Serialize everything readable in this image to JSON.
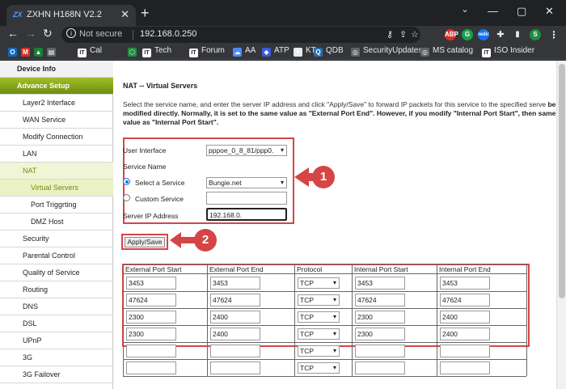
{
  "browser": {
    "tab_title": "ZXHN H168N V2.2",
    "tab_favicon": "ZX",
    "new_tab": "+",
    "close": "✕",
    "minimize": "—",
    "maximize": "▢",
    "not_secure": "Not secure",
    "url": "192.168.0.250",
    "redir_badge": "redir"
  },
  "bookmarks": [
    {
      "label": "",
      "icon": "outlook-icon",
      "color": "#0f6cbd",
      "glyph": "O"
    },
    {
      "label": "",
      "icon": "gmail-icon",
      "color": "#d93025",
      "glyph": "M"
    },
    {
      "label": "",
      "icon": "drive-icon",
      "color": "#188038",
      "glyph": "▲"
    },
    {
      "label": "",
      "icon": "sheets-icon",
      "color": "#5f6368",
      "glyph": "▤"
    },
    {
      "label": "Cal",
      "icon": "it-icon",
      "color": "#fff",
      "glyph": "IT"
    },
    {
      "label": "",
      "icon": "green-icon",
      "color": "#1e8e3e",
      "glyph": "⬡"
    },
    {
      "label": "Tech",
      "icon": "it-icon",
      "color": "#fff",
      "glyph": "IT"
    },
    {
      "label": "Forum",
      "icon": "it-icon",
      "color": "#fff",
      "glyph": "IT"
    },
    {
      "label": "AA",
      "icon": "cloud-icon",
      "color": "#4c8bf5",
      "glyph": "☁"
    },
    {
      "label": "ATP",
      "icon": "defender-icon",
      "color": "#3b5bdb",
      "glyph": "◆"
    },
    {
      "label": "KT",
      "icon": "pin-icon",
      "color": "#e8eaed",
      "glyph": "✦"
    },
    {
      "label": "QDB",
      "icon": "q-icon",
      "color": "#2b6cb0",
      "glyph": "Q"
    },
    {
      "label": "SecurityUpdates",
      "icon": "globe-icon",
      "color": "#5f6368",
      "glyph": "◎"
    },
    {
      "label": "MS catalog",
      "icon": "globe-icon",
      "color": "#5f6368",
      "glyph": "◎"
    },
    {
      "label": "ISO Insider",
      "icon": "it-icon",
      "color": "#fff",
      "glyph": "IT"
    }
  ],
  "sidebar": {
    "items": [
      {
        "label": "Device Info",
        "kind": "top"
      },
      {
        "label": "Advance Setup",
        "kind": "adv"
      },
      {
        "label": "Layer2 Interface",
        "kind": "l1"
      },
      {
        "label": "WAN Service",
        "kind": "l1"
      },
      {
        "label": "Modify Connection",
        "kind": "l1"
      },
      {
        "label": "LAN",
        "kind": "l1"
      },
      {
        "label": "NAT",
        "kind": "nat"
      },
      {
        "label": "Virtual Servers",
        "kind": "l2 active"
      },
      {
        "label": "Port Triggrting",
        "kind": "l2"
      },
      {
        "label": "DMZ Host",
        "kind": "l2"
      },
      {
        "label": "Security",
        "kind": "l1"
      },
      {
        "label": "Parental Control",
        "kind": "l1"
      },
      {
        "label": "Quality of Service",
        "kind": "l1"
      },
      {
        "label": "Routing",
        "kind": "l1"
      },
      {
        "label": "DNS",
        "kind": "l1"
      },
      {
        "label": "DSL",
        "kind": "l1"
      },
      {
        "label": "UPnP",
        "kind": "l1"
      },
      {
        "label": "3G",
        "kind": "l1"
      },
      {
        "label": "3G Failover",
        "kind": "l1"
      }
    ]
  },
  "main": {
    "title": "NAT -- Virtual Servers",
    "desc_normal": "Select the service name, and enter the server IP address and click \"Apply/Save\" to forward IP packets for this service to the specified serve",
    "desc_bold": "be modified directly. Normally, it is set to the same value as \"External Port End\". However, if you modify \"Internal Port Start\", then same value as \"Internal Port Start\".",
    "form": {
      "user_interface_label": "User Interface",
      "user_interface_value": "pppoe_0_8_81/ppp0.",
      "service_name_label": "Service Name",
      "select_service_label": "Select a Service",
      "select_service_value": "Bungie.net",
      "custom_service_label": "Custom Service",
      "custom_service_value": "",
      "server_ip_label": "Server IP Address",
      "server_ip_value": "192.168.0."
    },
    "apply_label": "Apply/Save",
    "callout_1": "1",
    "callout_2": "2",
    "table": {
      "headers": [
        "External Port Start",
        "External Port End",
        "Protocol",
        "Internal Port Start",
        "Internal Port End"
      ],
      "rows": [
        [
          "3453",
          "3453",
          "TCP",
          "3453",
          "3453"
        ],
        [
          "47624",
          "47624",
          "TCP",
          "47624",
          "47624"
        ],
        [
          "2300",
          "2400",
          "TCP",
          "2300",
          "2400"
        ],
        [
          "2300",
          "2400",
          "TCP",
          "2300",
          "2400"
        ],
        [
          "",
          "",
          "TCP",
          "",
          ""
        ],
        [
          "",
          "",
          "TCP",
          "",
          ""
        ]
      ]
    }
  }
}
